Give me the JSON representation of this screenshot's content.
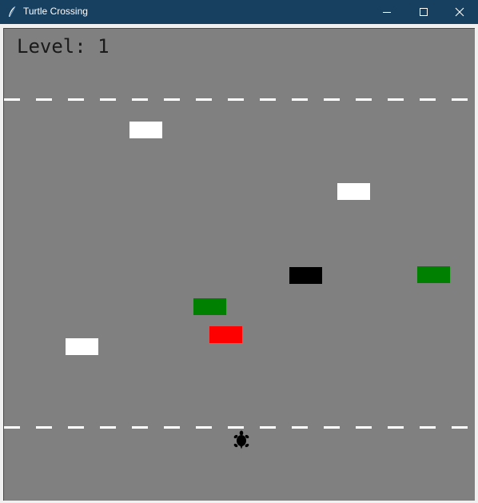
{
  "window": {
    "title": "Turtle Crossing",
    "app_icon": "feather-icon",
    "controls": [
      "minimize-icon",
      "maximize-icon",
      "close-icon"
    ]
  },
  "game": {
    "level_text": "Level: 1",
    "background_color": "#808080",
    "lane_line_color": "#ffffff",
    "player_color": "#000000",
    "cars": [
      {
        "color": "#ffffff"
      },
      {
        "color": "#ffffff"
      },
      {
        "color": "#000000"
      },
      {
        "color": "#008000"
      },
      {
        "color": "#008000"
      },
      {
        "color": "#ff0000"
      },
      {
        "color": "#ffffff"
      }
    ]
  }
}
